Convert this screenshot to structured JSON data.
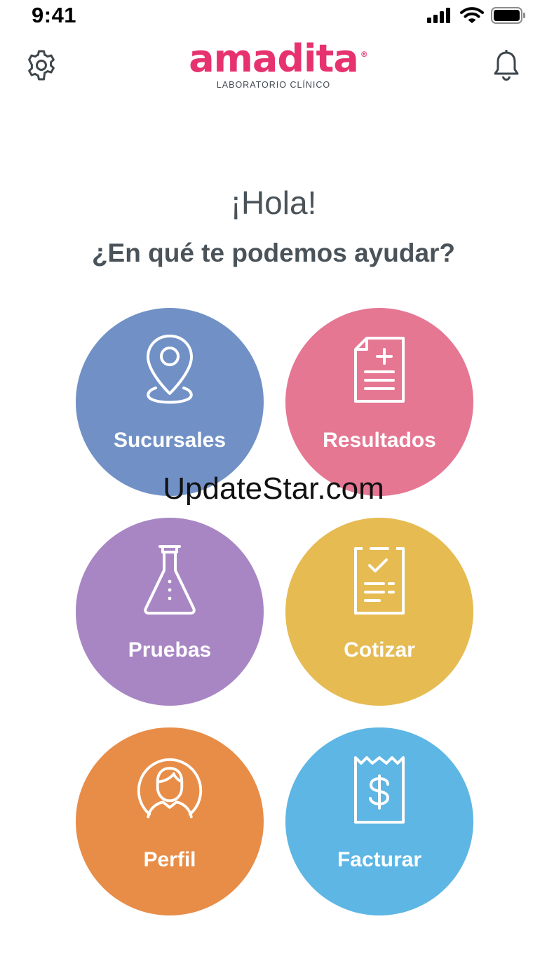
{
  "status_bar": {
    "time": "9:41"
  },
  "header": {
    "logo_text": "amadita",
    "logo_reg": "®",
    "logo_subtitle": "LABORATORIO CLÍNICO"
  },
  "greeting": "¡Hola!",
  "subheading": "¿En qué te podemos ayudar?",
  "tiles": [
    {
      "label": "Sucursales",
      "icon": "map-pin-icon",
      "color": "#7191c6"
    },
    {
      "label": "Resultados",
      "icon": "document-plus-icon",
      "color": "#e57793"
    },
    {
      "label": "Pruebas",
      "icon": "flask-icon",
      "color": "#a886c4"
    },
    {
      "label": "Cotizar",
      "icon": "checklist-icon",
      "color": "#e6bb52"
    },
    {
      "label": "Perfil",
      "icon": "user-icon",
      "color": "#e88d48"
    },
    {
      "label": "Facturar",
      "icon": "receipt-dollar-icon",
      "color": "#5db6e4"
    }
  ],
  "watermark": "UpdateStar.com",
  "colors": {
    "brand": "#e6336f",
    "text": "#4a5359"
  }
}
